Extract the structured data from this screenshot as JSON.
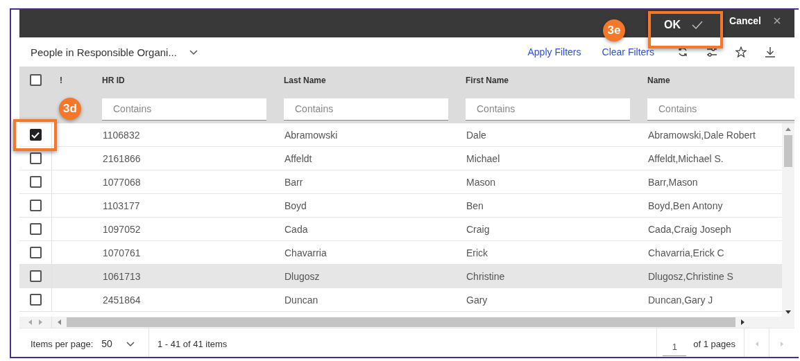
{
  "header": {
    "ok_button": {
      "label": "OK"
    },
    "cancel_button": {
      "label": "Cancel"
    }
  },
  "toolbar": {
    "view_title": "People in Responsible Organi...",
    "links": [
      "Apply Filters",
      "Clear Filters"
    ]
  },
  "table": {
    "select_all": {
      "checked": false
    },
    "columns": [
      {
        "label": "!"
      },
      {
        "label": "HR ID",
        "placeholder": "Contains"
      },
      {
        "label": "Last Name",
        "placeholder": "Contains"
      },
      {
        "label": "First Name",
        "placeholder": "Contains"
      },
      {
        "label": "Name",
        "placeholder": "Contains"
      }
    ],
    "rows": [
      {
        "checked": true,
        "hovered": false,
        "cells": [
          "",
          "1106832",
          "Abramowski",
          "Dale",
          "Abramowski,Dale Robert"
        ]
      },
      {
        "checked": false,
        "hovered": false,
        "cells": [
          "",
          "2161866",
          "Affeldt",
          "Michael",
          "Affeldt,Michael S."
        ]
      },
      {
        "checked": false,
        "hovered": false,
        "cells": [
          "",
          "1077068",
          "Barr",
          "Mason",
          "Barr,Mason"
        ]
      },
      {
        "checked": false,
        "hovered": false,
        "cells": [
          "",
          "1103177",
          "Boyd",
          "Ben",
          "Boyd,Ben Antony"
        ]
      },
      {
        "checked": false,
        "hovered": false,
        "cells": [
          "",
          "1097052",
          "Cada",
          "Craig",
          "Cada,Craig Joseph"
        ]
      },
      {
        "checked": false,
        "hovered": false,
        "cells": [
          "",
          "1070761",
          "Chavarria",
          "Erick",
          "Chavarria,Erick C"
        ]
      },
      {
        "checked": false,
        "hovered": true,
        "cells": [
          "",
          "1061713",
          "Dlugosz",
          "Christine",
          "Dlugosz,Christine S"
        ]
      },
      {
        "checked": false,
        "hovered": false,
        "cells": [
          "",
          "2451864",
          "Duncan",
          "Gary",
          "Duncan,Gary J"
        ]
      }
    ]
  },
  "footer": {
    "items_per_page_label": "Items per page:",
    "items_per_page": "50",
    "range": "1 - 41 of 41 items",
    "page": "1",
    "pages_label": "of 1 pages"
  },
  "annotations": [
    {
      "label": "3e",
      "kind": "button"
    },
    {
      "label": "3d",
      "kind": "checkbox"
    }
  ]
}
